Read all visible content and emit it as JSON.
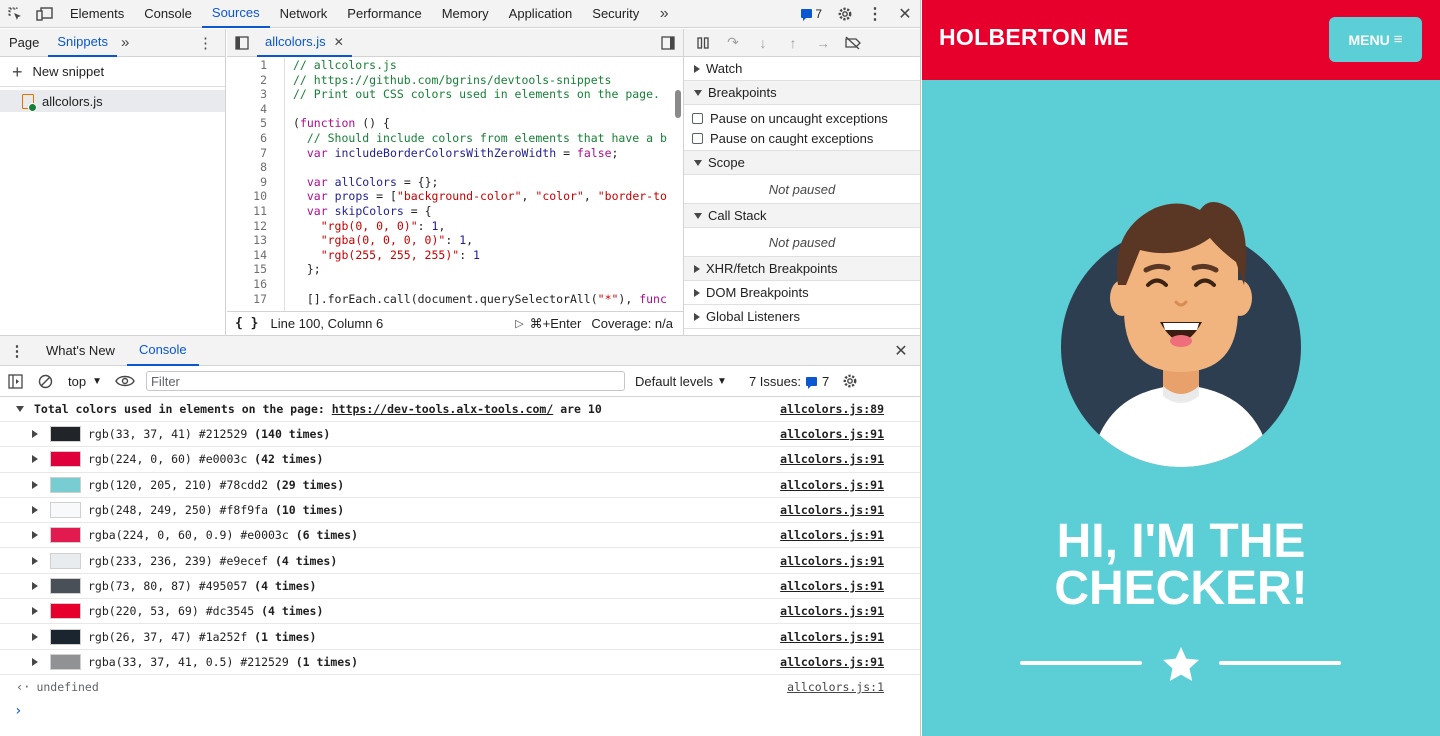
{
  "devtools": {
    "main_tabs": [
      "Elements",
      "Console",
      "Sources",
      "Network",
      "Performance",
      "Memory",
      "Application",
      "Security"
    ],
    "active_main_tab": "Sources",
    "issues_badge": "7",
    "navigator": {
      "tabs": [
        "Page",
        "Snippets"
      ],
      "new_snippet": "New snippet",
      "snippet_file": "allcolors.js"
    },
    "editor": {
      "tab_label": "allcolors.js",
      "status_position": "Line 100, Column 6",
      "run_shortcut": "⌘+Enter",
      "coverage": "Coverage: n/a",
      "line_numbers": [
        "1",
        "2",
        "3",
        "4",
        "5",
        "6",
        "7",
        "8",
        "9",
        "10",
        "11",
        "12",
        "13",
        "14",
        "15",
        "16",
        "17"
      ]
    },
    "debugger": {
      "watch": "Watch",
      "breakpoints": "Breakpoints",
      "pause_uncaught": "Pause on uncaught exceptions",
      "pause_caught": "Pause on caught exceptions",
      "scope": "Scope",
      "scope_status": "Not paused",
      "call_stack": "Call Stack",
      "call_stack_status": "Not paused",
      "xhr_breakpoints": "XHR/fetch Breakpoints",
      "dom_breakpoints": "DOM Breakpoints",
      "global_listeners": "Global Listeners"
    },
    "drawer": {
      "tabs": [
        "What's New",
        "Console"
      ],
      "context": "top",
      "filter_placeholder": "Filter",
      "levels": "Default levels",
      "issues_label": "7 Issues:",
      "issues_count": "7"
    },
    "console": {
      "group_prefix": "Total colors used in elements on the page: ",
      "group_link": "https://dev-tools.alx-tools.com/",
      "group_suffix": " are 10",
      "group_source": "allcolors.js:89",
      "rows": [
        {
          "text": "rgb(33, 37, 41) #212529 ",
          "count": "(140 times)",
          "color": "#212529",
          "source": "allcolors.js:91"
        },
        {
          "text": "rgb(224, 0, 60) #e0003c ",
          "count": "(42 times)",
          "color": "#e0003c",
          "source": "allcolors.js:91"
        },
        {
          "text": "rgb(120, 205, 210) #78cdd2 ",
          "count": "(29 times)",
          "color": "#78cdd2",
          "source": "allcolors.js:91"
        },
        {
          "text": "rgb(248, 249, 250) #f8f9fa ",
          "count": "(10 times)",
          "color": "#f8f9fa",
          "source": "allcolors.js:91"
        },
        {
          "text": "rgba(224, 0, 60, 0.9) #e0003c ",
          "count": "(6 times)",
          "color": "#e31a50",
          "source": "allcolors.js:91"
        },
        {
          "text": "rgb(233, 236, 239) #e9ecef ",
          "count": "(4 times)",
          "color": "#e9ecef",
          "source": "allcolors.js:91"
        },
        {
          "text": "rgb(73, 80, 87) #495057 ",
          "count": "(4 times)",
          "color": "#495057",
          "source": "allcolors.js:91"
        },
        {
          "text": "rgb(220, 53, 69) #dc3545 ",
          "count": "(4 times)",
          "color": "#e8002d",
          "source": "allcolors.js:91"
        },
        {
          "text": "rgb(26, 37, 47) #1a252f ",
          "count": "(1 times)",
          "color": "#1a252f",
          "source": "allcolors.js:91"
        },
        {
          "text": "rgba(33, 37, 41, 0.5) #212529 ",
          "count": "(1 times)",
          "color": "#909294",
          "source": "allcolors.js:91"
        }
      ],
      "result": "undefined",
      "result_source": "allcolors.js:1"
    }
  },
  "page": {
    "brand": "HOLBERTON ME",
    "menu_label": "MENU",
    "hero_line1": "HI, I'M THE",
    "hero_line2": "CHECKER!",
    "colors": {
      "header": "#e8002d",
      "background": "#5ccfd6",
      "avatar_circle": "#2c3e50"
    }
  }
}
